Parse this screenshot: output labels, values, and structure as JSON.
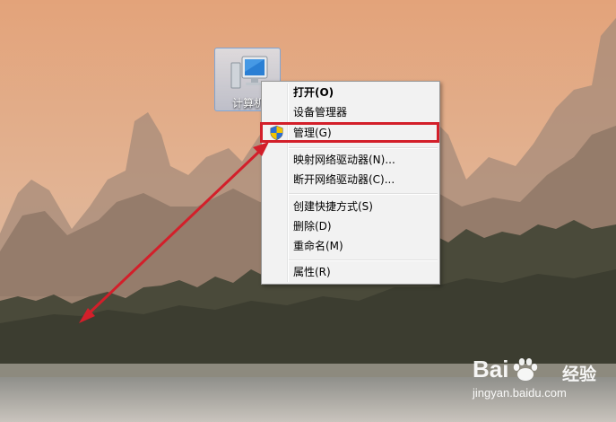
{
  "desktop_icon": {
    "label": "计算机",
    "icon": "computer-icon"
  },
  "context_menu": {
    "items": [
      {
        "label": "打开(O)",
        "bold": true
      },
      {
        "label": "设备管理器"
      },
      {
        "label": "管理(G)",
        "icon": "uac-shield-icon",
        "highlighted": true
      },
      {
        "label": "映射网络驱动器(N)..."
      },
      {
        "label": "断开网络驱动器(C)..."
      },
      {
        "label": "创建快捷方式(S)"
      },
      {
        "label": "删除(D)"
      },
      {
        "label": "重命名(M)"
      },
      {
        "label": "属性(R)"
      }
    ]
  },
  "annotation": {
    "color": "#d31f2a",
    "arrow_icon": "red-arrow"
  },
  "watermark": {
    "logo": "Bai",
    "logo_suffix": "经验",
    "url": "jingyan.baidu.com"
  }
}
